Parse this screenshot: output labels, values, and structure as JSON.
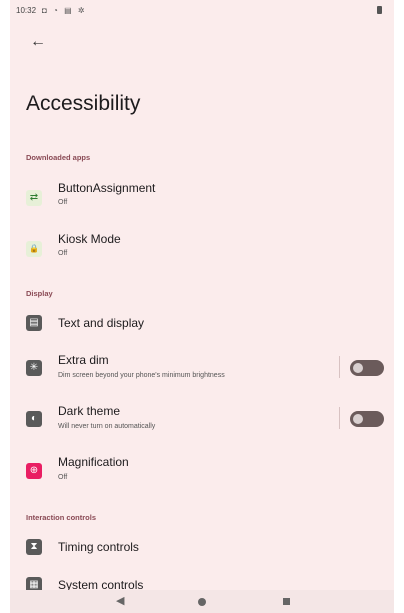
{
  "statusbar": {
    "time": "10:32",
    "icons": "◘ ◔ ▤ ✲"
  },
  "header": {
    "back_icon": "←",
    "title": "Accessibility"
  },
  "sections": {
    "downloaded_apps": "Downloaded apps",
    "display": "Display",
    "interaction_controls": "Interaction controls"
  },
  "items": {
    "button_assignment": {
      "title": "ButtonAssignment",
      "subtitle": "Off",
      "icon": "⇄"
    },
    "kiosk_mode": {
      "title": "Kiosk Mode",
      "subtitle": "Off",
      "icon": "🔒"
    },
    "text_display": {
      "title": "Text and display",
      "icon": "▤"
    },
    "extra_dim": {
      "title": "Extra dim",
      "subtitle": "Dim screen beyond your phone's minimum brightness",
      "icon": "✳",
      "toggle_on": false
    },
    "dark_theme": {
      "title": "Dark theme",
      "subtitle": "Will never turn on automatically",
      "icon": "◐",
      "toggle_on": false
    },
    "magnification": {
      "title": "Magnification",
      "subtitle": "Off",
      "icon": "⊕"
    },
    "timing_controls": {
      "title": "Timing controls",
      "icon": "⧗"
    },
    "system_controls": {
      "title": "System controls",
      "icon": "▦"
    }
  },
  "navbar": {
    "back_icon": "◀"
  },
  "colors": {
    "background": "#fbecec",
    "accent": "#8a4a55",
    "magnification": "#e91e63"
  }
}
